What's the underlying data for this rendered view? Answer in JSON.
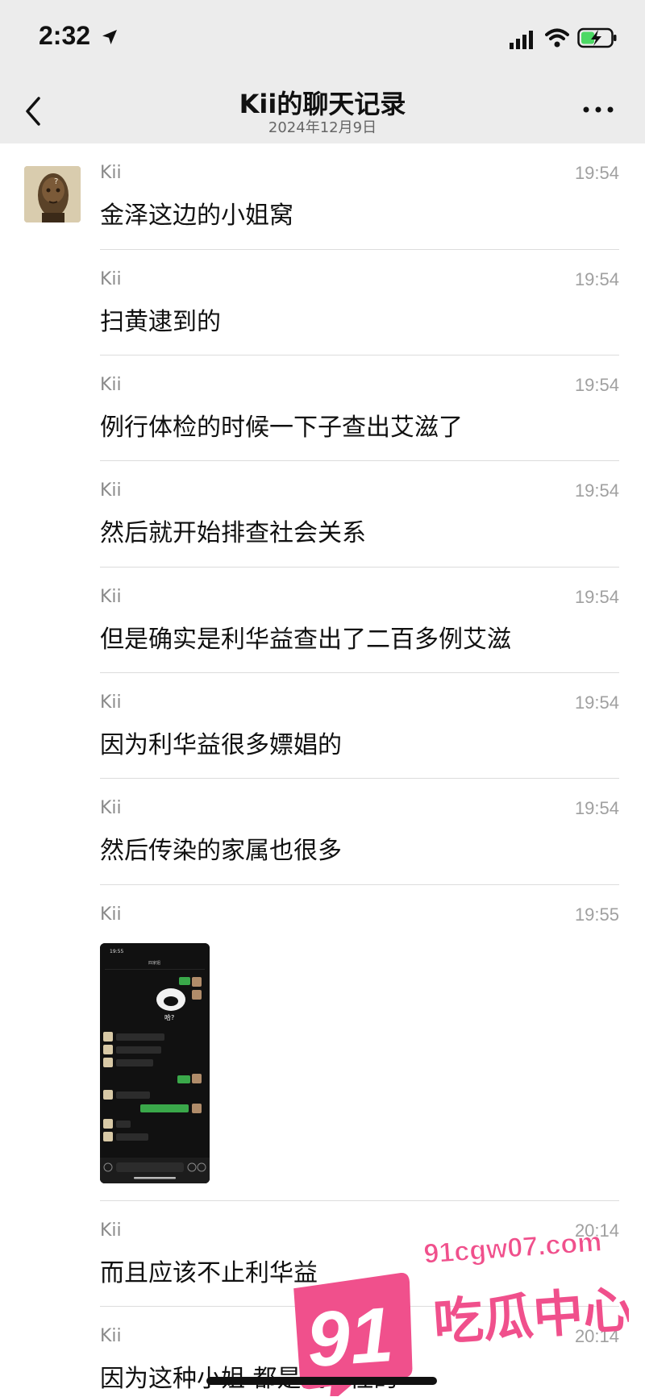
{
  "status_bar": {
    "time": "2:32",
    "icons": [
      "location-arrow-icon",
      "cellular-signal-icon",
      "wifi-icon",
      "battery-charging-icon"
    ]
  },
  "nav": {
    "title": "Kii的聊天记录",
    "subtitle": "2024年12月9日",
    "icons": [
      "back-chevron-icon",
      "more-icon"
    ]
  },
  "messages": [
    {
      "sender": "Kii",
      "time": "19:54",
      "text": "金泽这边的小姐窝"
    },
    {
      "sender": "Kii",
      "time": "19:54",
      "text": "扫黄逮到的"
    },
    {
      "sender": "Kii",
      "time": "19:54",
      "text": "例行体检的时候一下子查出艾滋了"
    },
    {
      "sender": "Kii",
      "time": "19:54",
      "text": "然后就开始排查社会关系"
    },
    {
      "sender": "Kii",
      "time": "19:54",
      "text": "但是确实是利华益查出了二百多例艾滋"
    },
    {
      "sender": "Kii",
      "time": "19:54",
      "text": "因为利华益很多嫖娼的"
    },
    {
      "sender": "Kii",
      "time": "19:54",
      "text": "然后传染的家属也很多"
    },
    {
      "sender": "Kii",
      "time": "19:55",
      "text": ""
    },
    {
      "sender": "Kii",
      "time": "20:14",
      "text": "而且应该不止利华益"
    },
    {
      "sender": "Kii",
      "time": "20:14",
      "text": "因为这种小姐 都是流动性的"
    }
  ],
  "screenshot_thumbnail": {
    "thumb_time": "19:55",
    "thumb_title": "四家姐",
    "emoji_caption": "哈?"
  },
  "watermark": {
    "domain": "91cgw07.com",
    "number": "91",
    "name": "吃瓜中心"
  },
  "colors": {
    "header_bg": "#ececec",
    "divider": "#dcdcdc",
    "watermark_pink": "#f0508c",
    "wechat_green": "#4cd964"
  }
}
